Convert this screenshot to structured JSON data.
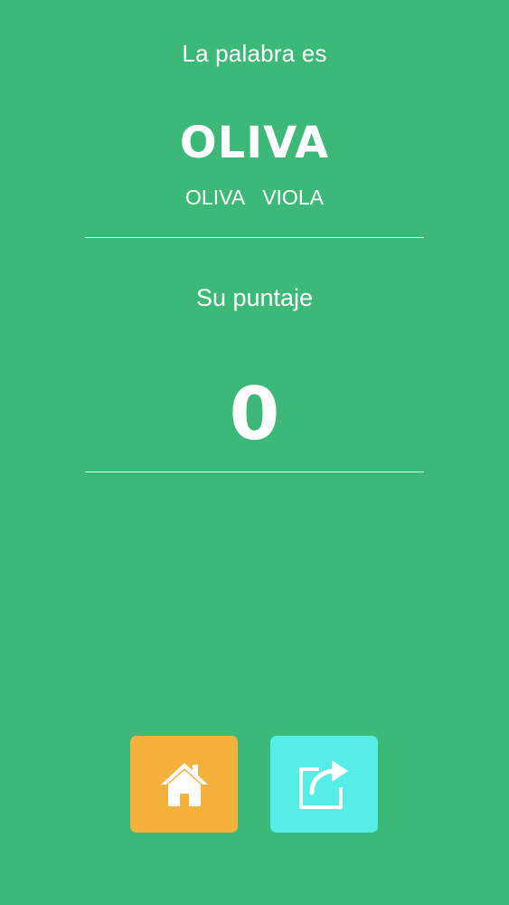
{
  "header": {
    "prompt": "La palabra es"
  },
  "result": {
    "word": "OLIVA",
    "candidates": [
      "OLIVA",
      "VIOLA"
    ]
  },
  "score": {
    "label": "Su puntaje",
    "value": "0"
  },
  "actions": {
    "home": {
      "icon": "home-icon",
      "color": "#f4b23d"
    },
    "share": {
      "icon": "share-icon",
      "color": "#55eee6"
    }
  },
  "colors": {
    "background": "#3cb878",
    "text": "#ffffff"
  }
}
